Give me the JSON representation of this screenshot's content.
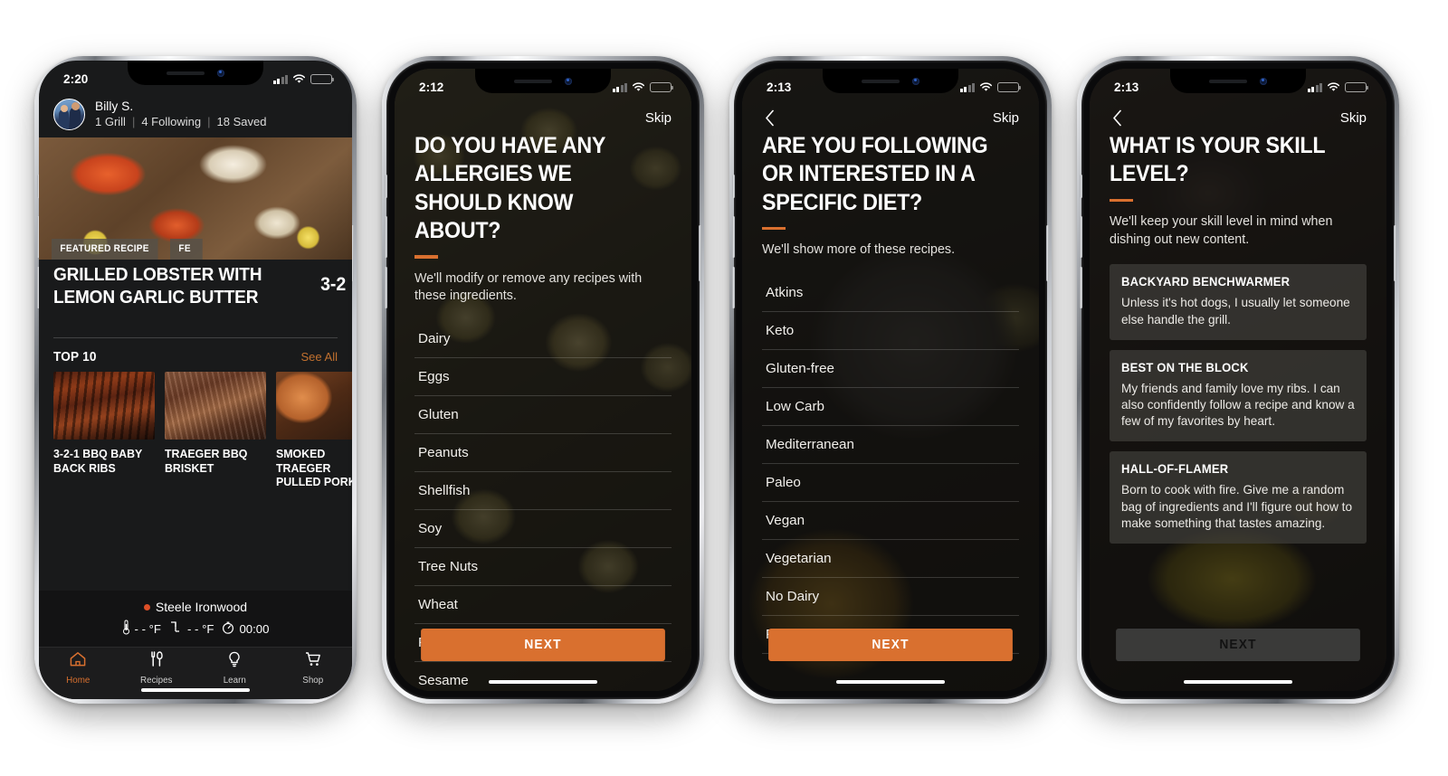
{
  "phones": [
    {
      "id": "home",
      "status": {
        "time": "2:20"
      },
      "profile": {
        "name": "Billy S.",
        "stat_grills": "1 Grill",
        "stat_following": "4 Following",
        "stat_saved": "18 Saved",
        "separator": "|"
      },
      "hero": {
        "badge": "FEATURED RECIPE",
        "badge_next": "FE"
      },
      "featured": {
        "title": "GRILLED LOBSTER WITH LEMON GARLIC BUTTER",
        "next_peek": "3-2"
      },
      "top10": {
        "label": "TOP 10",
        "see_all": "See All",
        "cards": [
          {
            "name": "3-2-1 BBQ BABY BACK RIBS"
          },
          {
            "name": "TRAEGER BBQ BRISKET"
          },
          {
            "name": "SMOKED TRAEGER PULLED PORK"
          }
        ]
      },
      "grill": {
        "name": "Steele Ironwood",
        "probe_temp": "- - °F",
        "grill_temp": "- - °F",
        "timer": "00:00"
      },
      "tabs": [
        {
          "label": "Home",
          "icon": "home-icon",
          "active": true
        },
        {
          "label": "Recipes",
          "icon": "utensils-icon",
          "active": false
        },
        {
          "label": "Learn",
          "icon": "lightbulb-icon",
          "active": false
        },
        {
          "label": "Shop",
          "icon": "cart-icon",
          "active": false
        }
      ]
    },
    {
      "id": "allergies",
      "status": {
        "time": "2:12"
      },
      "skip": "Skip",
      "has_back": false,
      "title": "DO YOU HAVE ANY ALLERGIES WE SHOULD KNOW ABOUT?",
      "subtitle": "We'll modify or remove any recipes with these ingredients.",
      "options": [
        "Dairy",
        "Eggs",
        "Gluten",
        "Peanuts",
        "Shellfish",
        "Soy",
        "Tree Nuts",
        "Wheat",
        "Fish",
        "Sesame"
      ],
      "next_label": "NEXT",
      "next_enabled": true
    },
    {
      "id": "diet",
      "status": {
        "time": "2:13"
      },
      "skip": "Skip",
      "has_back": true,
      "title": "ARE YOU FOLLOWING OR INTERESTED IN A SPECIFIC DIET?",
      "subtitle": "We'll show more of these recipes.",
      "options": [
        "Atkins",
        "Keto",
        "Gluten-free",
        "Low Carb",
        "Mediterranean",
        "Paleo",
        "Vegan",
        "Vegetarian",
        "No Dairy",
        "Pescatarian"
      ],
      "next_label": "NEXT",
      "next_enabled": true
    },
    {
      "id": "skill",
      "status": {
        "time": "2:13"
      },
      "skip": "Skip",
      "has_back": true,
      "title": "WHAT IS YOUR SKILL LEVEL?",
      "subtitle": "We'll keep your skill level in mind when dishing out new content.",
      "skill_levels": [
        {
          "name": "BACKYARD BENCHWARMER",
          "desc": "Unless it's hot dogs, I usually let someone else handle the grill."
        },
        {
          "name": "BEST ON THE BLOCK",
          "desc": "My friends and family love my ribs. I can also confidently follow a recipe and know a few of my favorites by heart."
        },
        {
          "name": "HALL-OF-FLAMER",
          "desc": "Born to cook with fire. Give me a random bag of ingredients and I'll figure out how to make something that tastes amazing."
        }
      ],
      "next_label": "NEXT",
      "next_enabled": false
    }
  ],
  "colors": {
    "accent_orange": "#d9702f",
    "see_all_orange": "#c2712f",
    "grill_dot": "#dd4f27",
    "battery_yellow": "#f5cf3c",
    "screen_dark": "#191a1b",
    "next_disabled_bg": "#3a3a39"
  }
}
